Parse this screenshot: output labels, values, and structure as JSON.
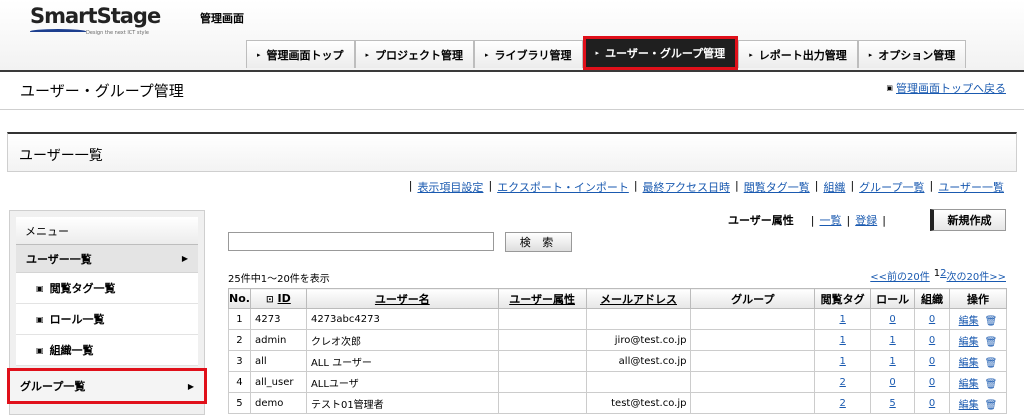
{
  "header": {
    "brand": "SmartStage",
    "tagline": "Design the next ICT style",
    "admin_title": "管理画面"
  },
  "nav": {
    "tabs": [
      {
        "label": "管理画面トップ",
        "active": false
      },
      {
        "label": "プロジェクト管理",
        "active": false
      },
      {
        "label": "ライブラリ管理",
        "active": false
      },
      {
        "label": "ユーザー・グループ管理",
        "active": true
      },
      {
        "label": "レポート出力管理",
        "active": false
      },
      {
        "label": "オプション管理",
        "active": false
      }
    ]
  },
  "page": {
    "title": "ユーザー・グループ管理",
    "back_link": "管理画面トップへ戻る",
    "section_title": "ユーザー一覧"
  },
  "links": [
    "表示項目設定",
    "エクスポート・インポート",
    "最終アクセス日時",
    "閲覧タグ一覧",
    "組織",
    "グループ一覧",
    "ユーザー一覧"
  ],
  "menu": {
    "head": "メニュー",
    "user_list": "ユーザー一覧",
    "subs": [
      "閲覧タグ一覧",
      "ロール一覧",
      "組織一覧"
    ],
    "group_list": "グループ一覧"
  },
  "attr_bar": {
    "label": "ユーザー属性",
    "list": "一覧",
    "register": "登録",
    "new_button": "新規作成"
  },
  "search": {
    "value": "",
    "button": "検 索"
  },
  "results": {
    "count": "25件中1～20件を表示",
    "prev": "<<前の20件",
    "page1": "1",
    "page2": "2",
    "next": "次の20件>>"
  },
  "table": {
    "headers": {
      "no": "No.",
      "id": "ID",
      "username": "ユーザー名",
      "attr": "ユーザー属性",
      "email": "メールアドレス",
      "group": "グループ",
      "tags": "閲覧タグ",
      "role": "ロール",
      "org": "組織",
      "ops": "操作"
    },
    "edit_label": "編集",
    "rows": [
      {
        "no": "1",
        "id": "4273",
        "name": "4273abc4273",
        "attr": "",
        "email": "",
        "group": "",
        "tags": "1",
        "role": "0",
        "org": "0"
      },
      {
        "no": "2",
        "id": "admin",
        "name": "クレオ次郎",
        "attr": "",
        "email": "jiro@test.co.jp",
        "group": "",
        "tags": "1",
        "role": "1",
        "org": "0"
      },
      {
        "no": "3",
        "id": "all",
        "name": "ALL ユーザー",
        "attr": "",
        "email": "all@test.co.jp",
        "group": "",
        "tags": "1",
        "role": "1",
        "org": "0"
      },
      {
        "no": "4",
        "id": "all_user",
        "name": "ALLユーザ",
        "attr": "",
        "email": "",
        "group": "",
        "tags": "2",
        "role": "0",
        "org": "0"
      },
      {
        "no": "5",
        "id": "demo",
        "name": "テスト01管理者",
        "attr": "",
        "email": "test@test.co.jp",
        "group": "",
        "tags": "2",
        "role": "5",
        "org": "0"
      }
    ]
  }
}
